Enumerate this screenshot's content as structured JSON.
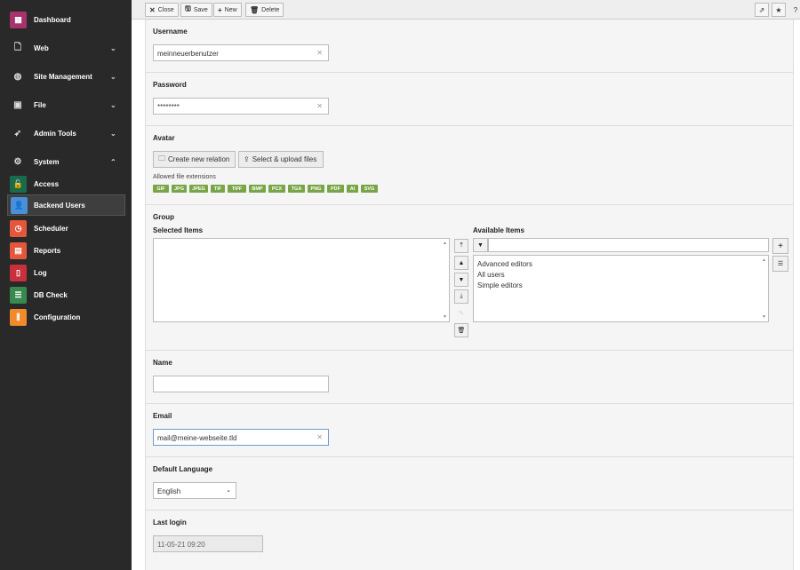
{
  "sidebar": {
    "items": [
      {
        "label": "Dashboard",
        "color": "#a6336b"
      },
      {
        "label": "Web"
      },
      {
        "label": "Site Management"
      },
      {
        "label": "File"
      },
      {
        "label": "Admin Tools"
      },
      {
        "label": "System"
      },
      {
        "label": "Access",
        "color": "#1b6b4a"
      },
      {
        "label": "Backend Users",
        "color": "#4a90d9"
      },
      {
        "label": "Scheduler",
        "color": "#e5573b"
      },
      {
        "label": "Reports",
        "color": "#e5573b"
      },
      {
        "label": "Log",
        "color": "#c9303d"
      },
      {
        "label": "DB Check",
        "color": "#37894e"
      },
      {
        "label": "Configuration",
        "color": "#f08a2a"
      }
    ]
  },
  "toolbar": {
    "close": "Close",
    "save": "Save",
    "new": "New",
    "delete": "Delete"
  },
  "form": {
    "username": {
      "label": "Username",
      "value": "meinneuerbenutzer"
    },
    "password": {
      "label": "Password",
      "value": "********"
    },
    "avatar": {
      "label": "Avatar",
      "create_relation": "Create new relation",
      "upload": "Select & upload files",
      "allowed_label": "Allowed file extensions",
      "extensions": [
        "GIF",
        "JPG",
        "JPEG",
        "TIF",
        "TIFF",
        "BMP",
        "PCX",
        "TGA",
        "PNG",
        "PDF",
        "AI",
        "SVG"
      ]
    },
    "group": {
      "label": "Group",
      "selected_label": "Selected Items",
      "available_label": "Available Items",
      "available": [
        "Advanced editors",
        "All users",
        "Simple editors"
      ]
    },
    "name": {
      "label": "Name",
      "value": ""
    },
    "email": {
      "label": "Email",
      "value": "mail@meine-webseite.tld"
    },
    "language": {
      "label": "Default Language",
      "value": "English"
    },
    "last_login": {
      "label": "Last login",
      "value": "11-05-21 09:20"
    }
  }
}
